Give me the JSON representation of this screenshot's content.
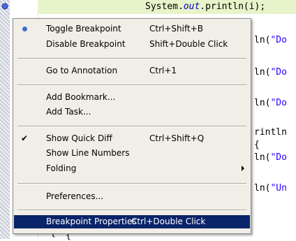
{
  "editor": {
    "line1": {
      "prefix": "System.",
      "out": "out",
      "suffix": ".println(i);"
    },
    "lines": [
      {
        "text": "ln(\"Do"
      },
      {
        "text": "ln(\"Do"
      },
      {
        "text": "ln(\"Do"
      },
      {
        "text": "rintln"
      },
      {
        "text": "{"
      },
      {
        "text": "ln(\"Do"
      },
      {
        "text": "ln(\"Un"
      }
    ],
    "braces": [
      "{",
      "{"
    ]
  },
  "menu": {
    "items": [
      {
        "label": "Toggle Breakpoint",
        "accel": "Ctrl+Shift+B",
        "marker": "radio"
      },
      {
        "label": "Disable Breakpoint",
        "accel": "Shift+Double Click"
      },
      {
        "label": "Go to Annotation",
        "accel": "Ctrl+1"
      },
      {
        "label": "Add Bookmark...",
        "accel": ""
      },
      {
        "label": "Add Task...",
        "accel": ""
      },
      {
        "label": "Show Quick Diff",
        "accel": "Ctrl+Shift+Q",
        "marker": "check"
      },
      {
        "label": "Show Line Numbers",
        "accel": ""
      },
      {
        "label": "Folding",
        "accel": "",
        "submenu": true
      },
      {
        "label": "Preferences...",
        "accel": ""
      },
      {
        "label": "Breakpoint Properties",
        "accel": "Ctrl+Double Click",
        "selected": true
      }
    ],
    "check_glyph": "✔"
  },
  "colors": {
    "menu_bg": "#f0eee6",
    "selection_bg": "#0a246a",
    "current_line_bg": "#e7f3c9",
    "radio": "#3b6fd0",
    "string": "#2a00ff",
    "field": "#0000c0"
  }
}
